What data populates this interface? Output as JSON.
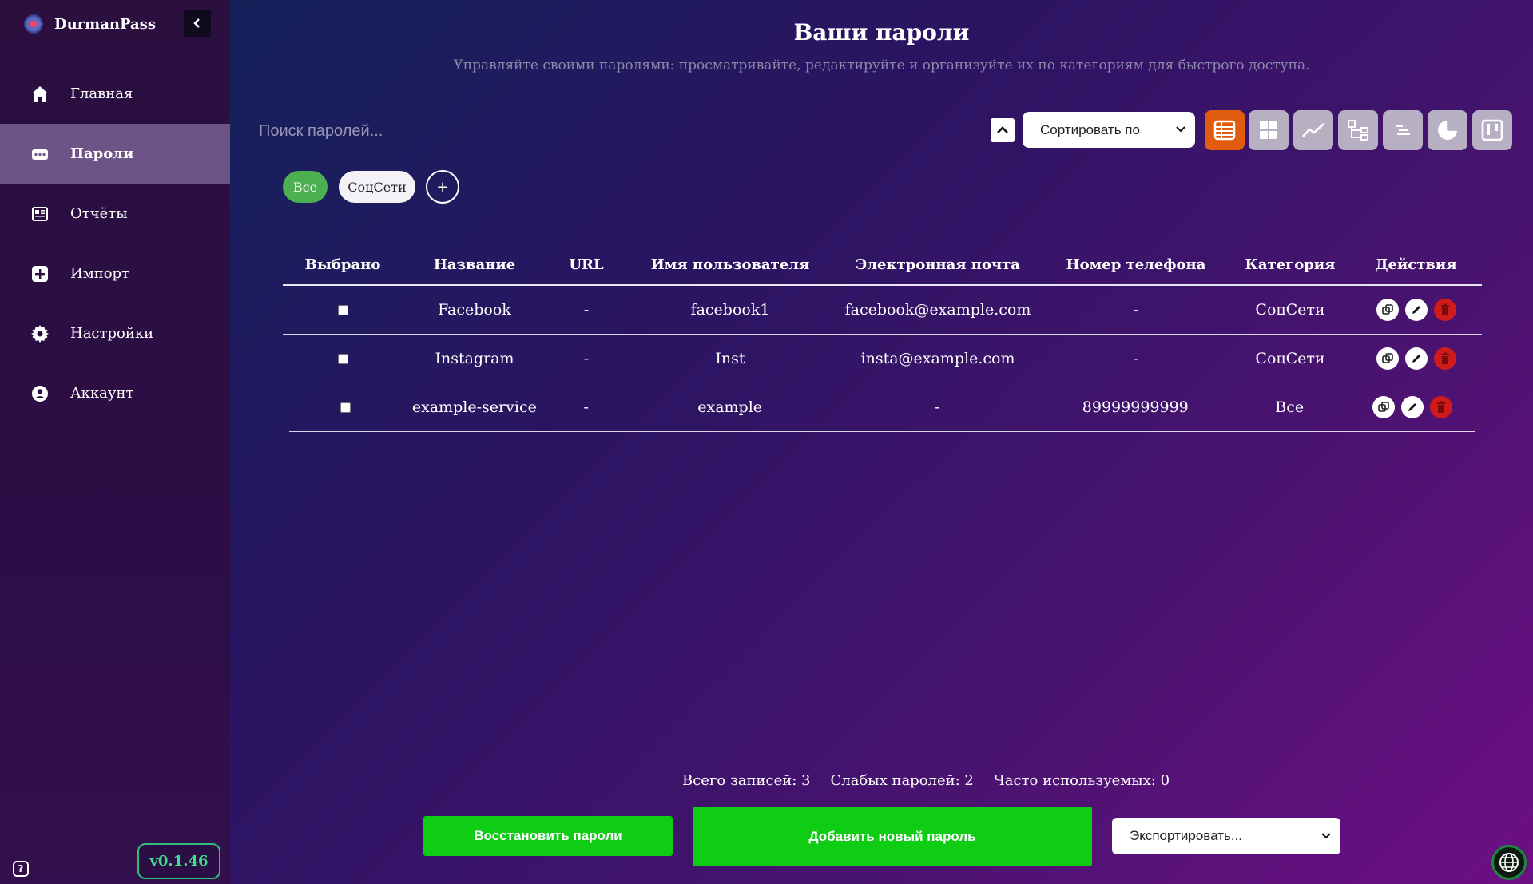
{
  "app": {
    "name": "DurmanPass",
    "version": "v0.1.46"
  },
  "sidebar": {
    "collapse_icon": "chevron-left-icon",
    "items": [
      {
        "label": "Главная",
        "icon": "home-icon"
      },
      {
        "label": "Пароли",
        "icon": "password-icon",
        "active": true
      },
      {
        "label": "Отчёты",
        "icon": "report-icon"
      },
      {
        "label": "Импорт",
        "icon": "import-icon"
      },
      {
        "label": "Настройки",
        "icon": "gear-icon"
      },
      {
        "label": "Аккаунт",
        "icon": "account-icon"
      }
    ]
  },
  "header": {
    "title": "Ваши пароли",
    "subtitle": "Управляйте своими паролями: просматривайте, редактируйте и организуйте их по категориям для быстрого доступа."
  },
  "toolbar": {
    "search_placeholder": "Поиск паролей...",
    "sort_label": "Сортировать по",
    "views": [
      "table-view-icon",
      "grid-view-icon",
      "chart-view-icon",
      "tree-view-icon",
      "timeline-view-icon",
      "pie-view-icon",
      "kanban-view-icon"
    ],
    "active_view": "table-view-icon"
  },
  "categories": {
    "items": [
      "Все",
      "СоцСети"
    ],
    "add_label": "+",
    "selected": "Все"
  },
  "table": {
    "headers": [
      "Выбрано",
      "Название",
      "URL",
      "Имя пользователя",
      "Электронная почта",
      "Номер телефона",
      "Категория",
      "Действия"
    ],
    "rows": [
      {
        "name": "Facebook",
        "url": "-",
        "username": "facebook1",
        "email": "facebook@example.com",
        "phone": "-",
        "category": "СоцСети"
      },
      {
        "name": "Instagram",
        "url": "-",
        "username": "Inst",
        "email": "insta@example.com",
        "phone": "-",
        "category": "СоцСети"
      },
      {
        "name": "example-service",
        "url": "-",
        "username": "example",
        "email": "-",
        "phone": "89999999999",
        "category": "Все"
      }
    ]
  },
  "stats": {
    "total": "Всего записей: 3",
    "weak": "Слабых паролей: 2",
    "frequent": "Часто используемых: 0"
  },
  "footer": {
    "restore_label": "Восстановить пароли",
    "add_label": "Добавить новый пароль",
    "export_label": "Экспортировать..."
  },
  "colors": {
    "accent_green": "#0fcc15",
    "active_view": "#e05d10",
    "delete_red": "#d11b1b",
    "version_green": "#3fe08d"
  }
}
